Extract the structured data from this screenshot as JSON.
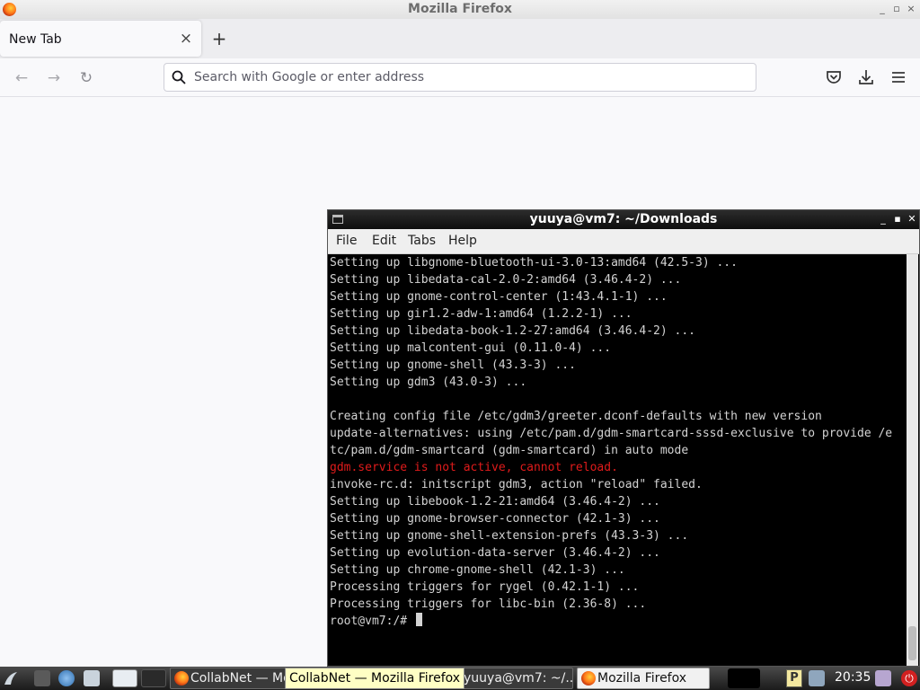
{
  "firefox": {
    "window_title": "Mozilla Firefox",
    "tab": {
      "title": "New Tab",
      "close_glyph": "×"
    },
    "new_tab_glyph": "+",
    "nav": {
      "back_glyph": "←",
      "forward_glyph": "→",
      "reload_glyph": "↻"
    },
    "urlbar": {
      "placeholder": "Search with Google or enter address",
      "value": ""
    },
    "window_controls": [
      "_",
      "▫",
      "×"
    ]
  },
  "terminal": {
    "title": "yuuya@vm7: ~/Downloads",
    "menu": [
      "File",
      "Edit",
      "Tabs",
      "Help"
    ],
    "lines": [
      {
        "text": "Setting up libgnome-bluetooth-ui-3.0-13:amd64 (42.5-3) ...",
        "error": false
      },
      {
        "text": "Setting up libedata-cal-2.0-2:amd64 (3.46.4-2) ...",
        "error": false
      },
      {
        "text": "Setting up gnome-control-center (1:43.4.1-1) ...",
        "error": false
      },
      {
        "text": "Setting up gir1.2-adw-1:amd64 (1.2.2-1) ...",
        "error": false
      },
      {
        "text": "Setting up libedata-book-1.2-27:amd64 (3.46.4-2) ...",
        "error": false
      },
      {
        "text": "Setting up malcontent-gui (0.11.0-4) ...",
        "error": false
      },
      {
        "text": "Setting up gnome-shell (43.3-3) ...",
        "error": false
      },
      {
        "text": "Setting up gdm3 (43.0-3) ...",
        "error": false
      },
      {
        "text": "",
        "error": false
      },
      {
        "text": "Creating config file /etc/gdm3/greeter.dconf-defaults with new version",
        "error": false
      },
      {
        "text": "update-alternatives: using /etc/pam.d/gdm-smartcard-sssd-exclusive to provide /e",
        "error": false
      },
      {
        "text": "tc/pam.d/gdm-smartcard (gdm-smartcard) in auto mode",
        "error": false
      },
      {
        "text": "gdm.service is not active, cannot reload.",
        "error": true
      },
      {
        "text": "invoke-rc.d: initscript gdm3, action \"reload\" failed.",
        "error": false
      },
      {
        "text": "Setting up libebook-1.2-21:amd64 (3.46.4-2) ...",
        "error": false
      },
      {
        "text": "Setting up gnome-browser-connector (42.1-3) ...",
        "error": false
      },
      {
        "text": "Setting up gnome-shell-extension-prefs (43.3-3) ...",
        "error": false
      },
      {
        "text": "Setting up evolution-data-server (3.46.4-2) ...",
        "error": false
      },
      {
        "text": "Setting up chrome-gnome-shell (42.1-3) ...",
        "error": false
      },
      {
        "text": "Processing triggers for rygel (0.42.1-1) ...",
        "error": false
      },
      {
        "text": "Processing triggers for libc-bin (2.36-8) ...",
        "error": false
      }
    ],
    "prompt": "root@vm7:/# "
  },
  "taskbar": {
    "tasks": [
      {
        "label": "CollabNet — Mo",
        "active": false
      },
      {
        "label": "yuuya@vm7: ~/...",
        "active": false
      },
      {
        "label": "Mozilla Firefox",
        "active": true
      }
    ],
    "tooltip": "CollabNet — Mozilla Firefox",
    "clock": "20:35",
    "pager_label": "P"
  },
  "colors": {
    "terminal_bg": "#000000",
    "terminal_fg": "#d3d3d3",
    "error_red": "#e01b1b",
    "tooltip_bg": "#ffffc4"
  }
}
